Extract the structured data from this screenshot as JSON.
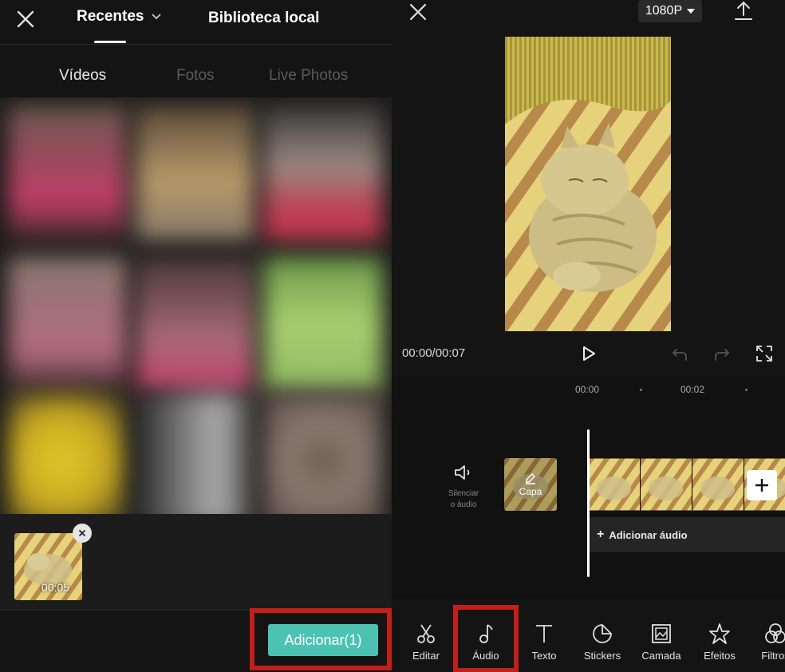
{
  "colors": {
    "accent_button": "#4cc2b3",
    "highlight_box": "#c21f18",
    "background": "#141414"
  },
  "left_panel": {
    "close_icon": "close-icon",
    "tabs": {
      "recentes": "Recentes",
      "biblioteca_local": "Biblioteca local"
    },
    "media_tabs": [
      {
        "label": "Vídeos"
      },
      {
        "label": "Fotos"
      },
      {
        "label": "Live Photos"
      }
    ],
    "selected_item": {
      "duration": "00:05"
    },
    "add_button_label": "Adicionar(1)"
  },
  "right_panel": {
    "resolution": "1080P",
    "playback": {
      "time": "00:00/00:07"
    },
    "ruler": [
      "00:00",
      "00:02"
    ],
    "mute": {
      "label_line1": "Silenciar",
      "label_line2": "o áudio"
    },
    "cover_label": "Capa",
    "add_audio_label": "Adicionar áudio",
    "toolbar": [
      {
        "label": "Editar",
        "icon": "scissors-icon"
      },
      {
        "label": "Áudio",
        "icon": "music-note-icon"
      },
      {
        "label": "Texto",
        "icon": "text-icon"
      },
      {
        "label": "Stickers",
        "icon": "sticker-icon"
      },
      {
        "label": "Camada",
        "icon": "layer-icon"
      },
      {
        "label": "Efeitos",
        "icon": "effects-icon"
      },
      {
        "label": "Filtros",
        "icon": "filters-icon"
      }
    ]
  }
}
